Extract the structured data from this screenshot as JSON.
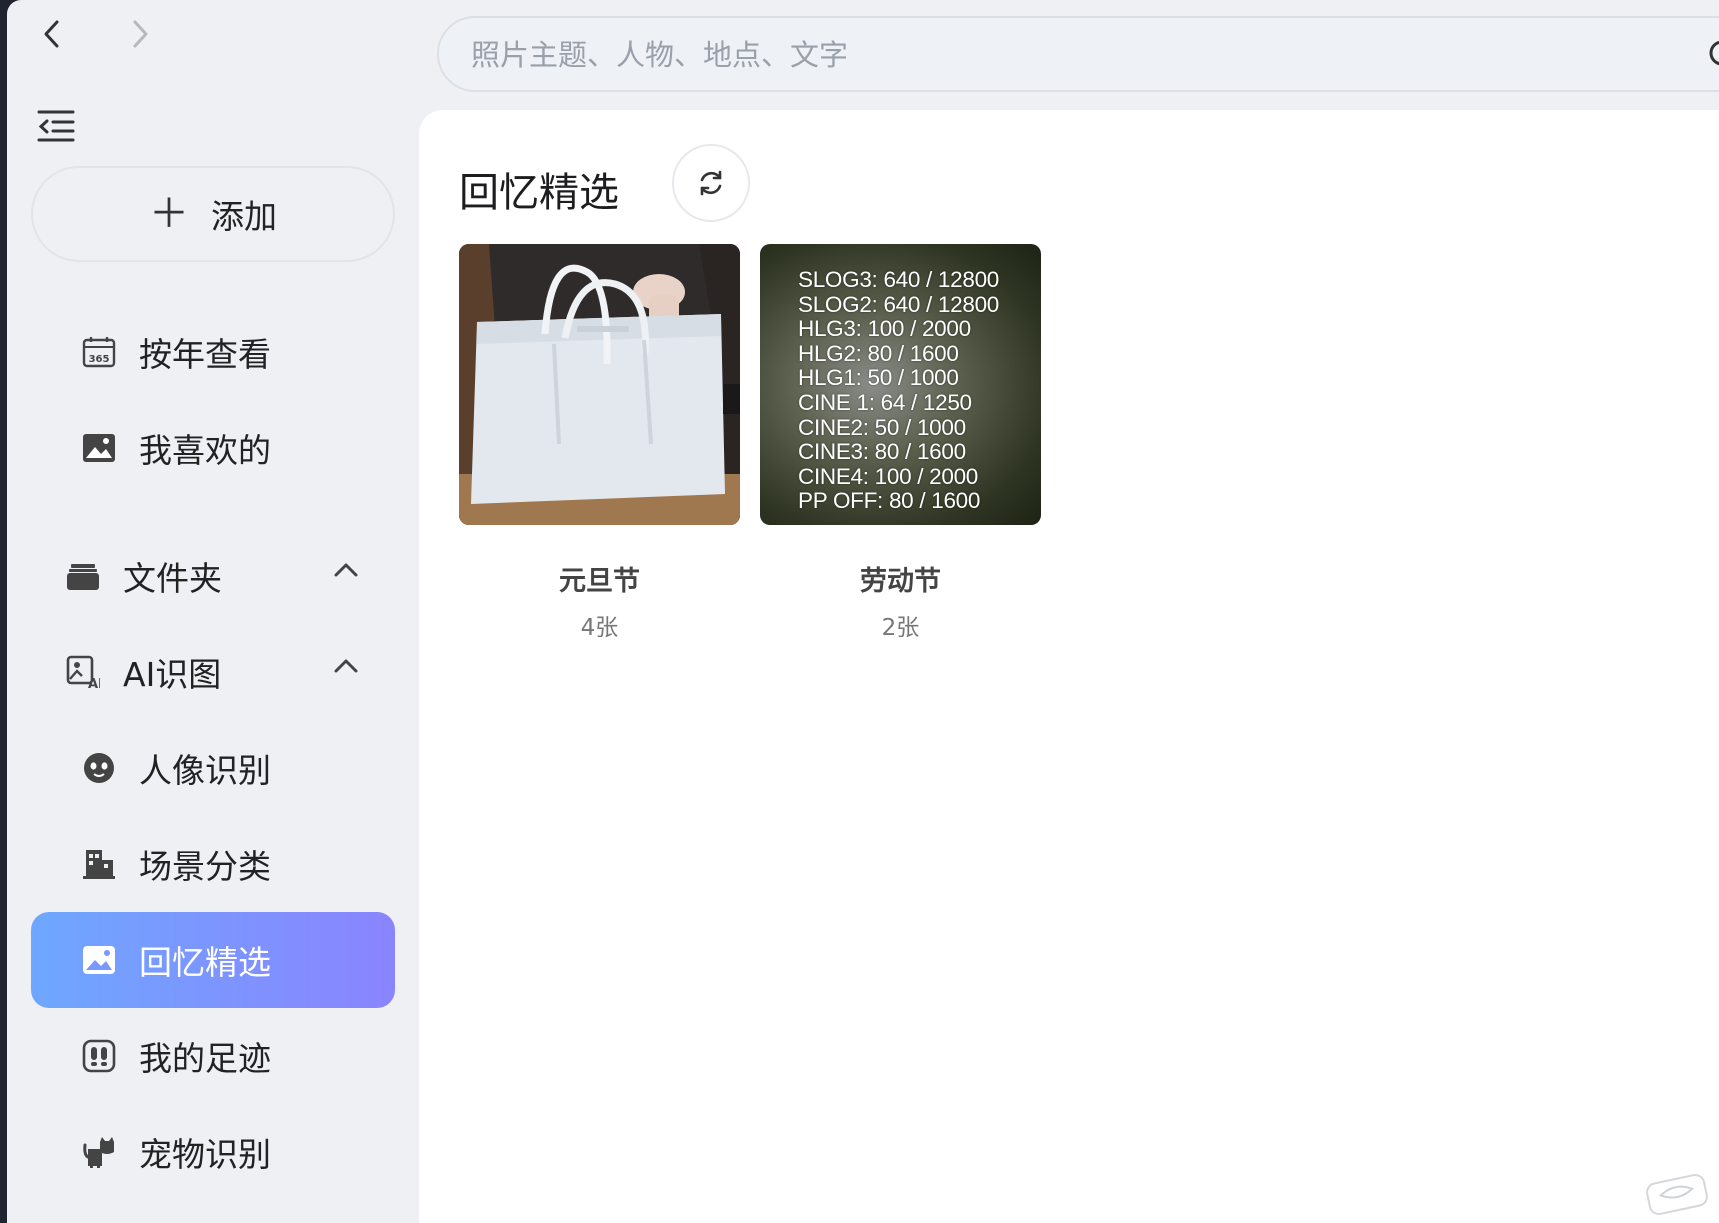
{
  "nav": {
    "back_icon": "chevron-left-icon",
    "forward_icon": "chevron-right-icon",
    "collapse_icon": "menu-collapse-icon"
  },
  "search": {
    "placeholder": "照片主题、人物、地点、文字",
    "value": ""
  },
  "sidebar": {
    "add_label": "添加",
    "items": [
      {
        "label": "按年查看",
        "icon": "calendar-365-icon"
      },
      {
        "label": "我喜欢的",
        "icon": "picture-icon"
      }
    ],
    "groups": [
      {
        "label": "文件夹",
        "icon": "folder-icon",
        "expanded": true
      },
      {
        "label": "AI识图",
        "icon": "ai-image-icon",
        "expanded": true
      }
    ],
    "ai_items": [
      {
        "label": "人像识别",
        "icon": "face-icon"
      },
      {
        "label": "场景分类",
        "icon": "building-icon"
      },
      {
        "label": "回忆精选",
        "icon": "image-icon",
        "active": true
      },
      {
        "label": "我的足迹",
        "icon": "footprint-icon"
      },
      {
        "label": "宠物识别",
        "icon": "pet-cat-icon"
      }
    ],
    "accent_gradient": [
      "#6ea7ff",
      "#8a84ff"
    ]
  },
  "main": {
    "title": "回忆精选",
    "albums": [
      {
        "title": "元旦节",
        "count": "4张",
        "thumb": "white-handbag-photo"
      },
      {
        "title": "劳动节",
        "count": "2张",
        "thumb": "text-overlay-photo",
        "overlay_text": [
          "SLOG3: 640 / 12800",
          "SLOG2: 640 / 12800",
          "HLG3: 100 / 2000",
          "HLG2: 80 / 1600",
          "HLG1: 50 / 1000",
          "CINE 1: 64 / 1250",
          "CINE2: 50 / 1000",
          "CINE3: 80 / 1600",
          "CINE4: 100 / 2000",
          "PP OFF: 80 / 1600"
        ]
      }
    ]
  }
}
